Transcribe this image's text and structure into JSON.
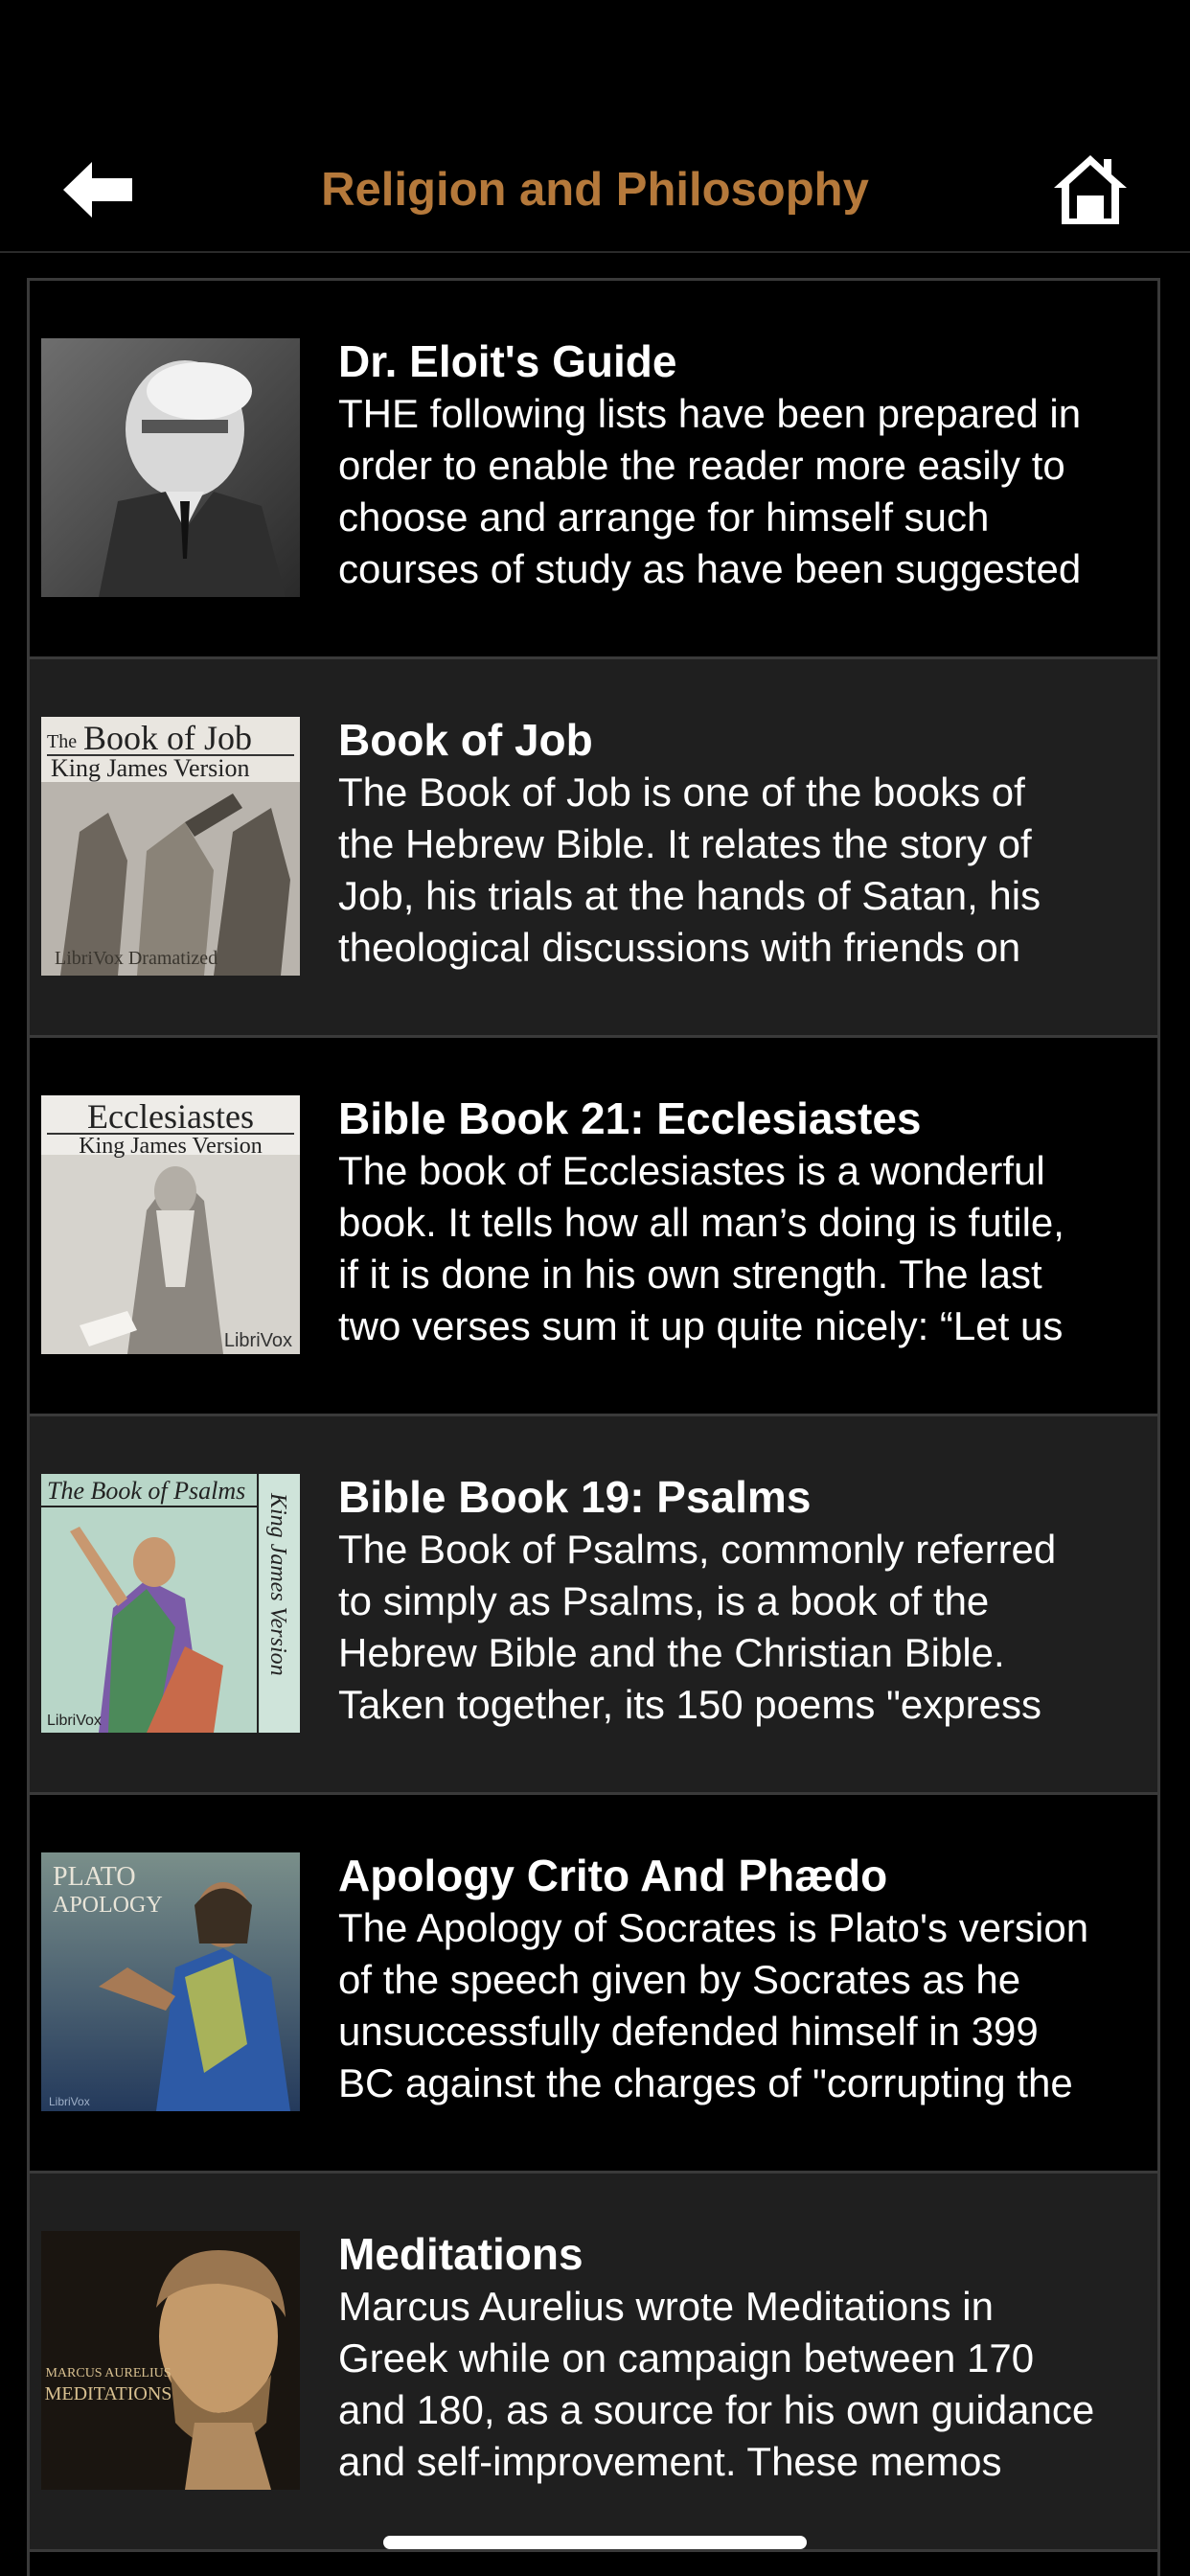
{
  "app": {
    "accent_color": "#b5793b"
  },
  "nav": {
    "back_icon": "back-arrow-icon",
    "title": "Religion and Philosophy",
    "home_icon": "home-icon"
  },
  "items": [
    {
      "title": "Dr. Eloit's Guide",
      "desc_lines": [
        "THE following lists have been prepared in",
        "order to enable the reader more easily to",
        "choose and arrange for himself such",
        "courses of study as have been suggested"
      ]
    },
    {
      "title": "Book of Job",
      "cover": {
        "line1_small": "The",
        "line1": "Book of Job",
        "line2": "King James Version",
        "footer": "LibriVox  Dramatized"
      },
      "desc_lines": [
        "The Book of Job is one of the books of",
        "the Hebrew Bible. It relates the story of",
        "Job, his trials at the hands of Satan, his",
        "theological discussions with friends on"
      ]
    },
    {
      "title": "Bible Book 21: Ecclesiastes",
      "cover": {
        "line1": "Ecclesiastes",
        "line2": "King James Version",
        "footer": "LibriVox"
      },
      "desc_lines": [
        "The book of Ecclesiastes is a wonderful",
        "book. It tells how all man’s doing is futile,",
        "if it is done in his own strength. The last",
        "two verses sum it up quite nicely: “Let us"
      ]
    },
    {
      "title": "Bible Book 19: Psalms",
      "cover": {
        "line1": "The Book of Psalms",
        "side": "King James Version",
        "footer": "LibriVox"
      },
      "desc_lines": [
        "The Book of Psalms, commonly referred",
        "to simply as Psalms, is a book of the",
        "Hebrew Bible and the Christian Bible.",
        "Taken together, its 150 poems \"express"
      ]
    },
    {
      "title": "Apology Crito And Phædo",
      "cover": {
        "line1": "PLATO",
        "line2": "APOLOGY",
        "footer": "LibriVox"
      },
      "desc_lines": [
        "The Apology of Socrates is Plato's version",
        "of the speech given by Socrates as he",
        "unsuccessfully defended himself in 399",
        "BC against the charges of \"corrupting the"
      ]
    },
    {
      "title": "Meditations",
      "cover": {
        "line1": "MARCUS AURELIUS",
        "line2": "MEDITATIONS"
      },
      "desc_lines": [
        "Marcus Aurelius wrote Meditations in",
        "Greek while on campaign between 170",
        "and 180, as a source for his own guidance",
        "and self-improvement. These memos"
      ]
    }
  ]
}
